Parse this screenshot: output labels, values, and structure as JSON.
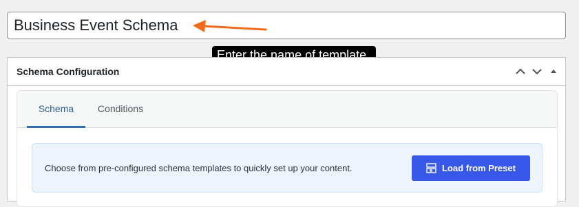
{
  "title_field": {
    "value": "Business Event Schema"
  },
  "annotation": {
    "tooltip": "Enter the name of template",
    "arrow_color": "#f26b1d"
  },
  "metabox": {
    "title": "Schema Configuration",
    "actions": [
      "chevron-up-icon",
      "chevron-down-icon",
      "triangle-up-icon"
    ]
  },
  "tabs": [
    {
      "label": "Schema",
      "active": true
    },
    {
      "label": "Conditions",
      "active": false
    }
  ],
  "preset": {
    "description": "Choose from pre-configured schema templates to quickly set up your content.",
    "button_label": "Load from Preset",
    "button_icon": "layout-icon",
    "button_color": "#3858e9"
  }
}
